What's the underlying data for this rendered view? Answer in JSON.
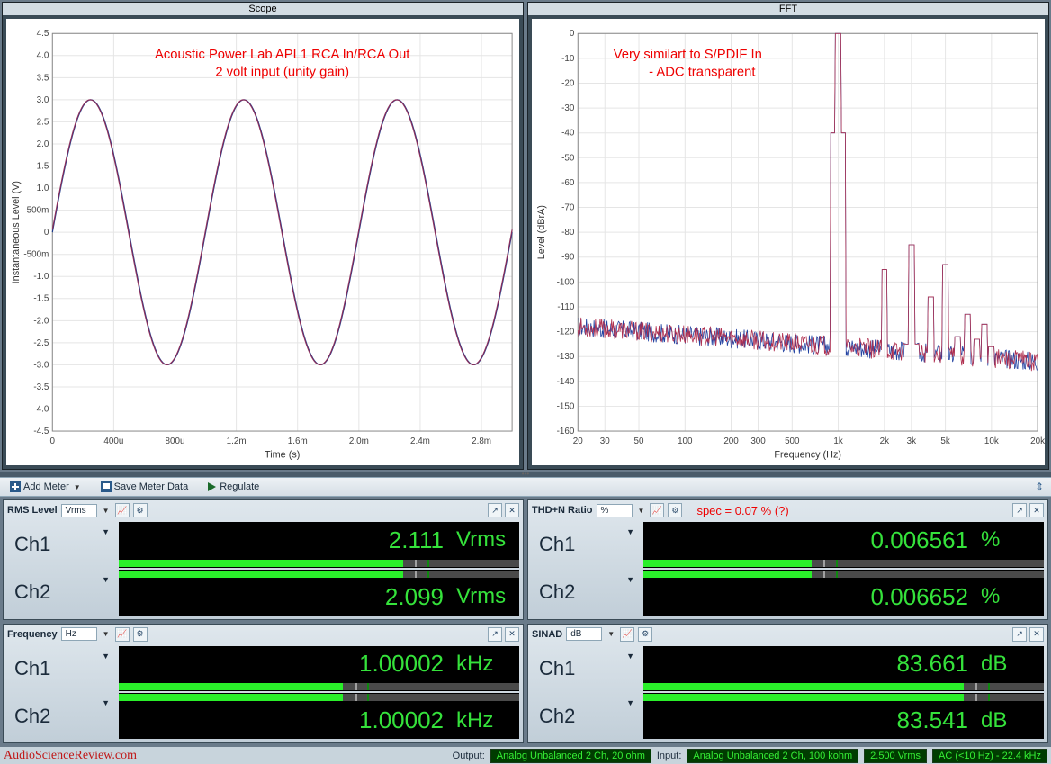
{
  "scope": {
    "title": "Scope",
    "xlabel": "Time (s)",
    "ylabel": "Instantaneous Level (V)",
    "annot1": "Acoustic Power Lab APL1 RCA In/RCA Out",
    "annot2": "2 volt input (unity gain)",
    "xticks": [
      "0",
      "400u",
      "800u",
      "1.2m",
      "1.6m",
      "2.0m",
      "2.4m",
      "2.8m"
    ],
    "yticks": [
      "-4.5",
      "-4.0",
      "-3.5",
      "-3.0",
      "-2.5",
      "-2.0",
      "-1.5",
      "-1.0",
      "-500m",
      "0",
      "500m",
      "1.0",
      "1.5",
      "2.0",
      "2.5",
      "3.0",
      "3.5",
      "4.0",
      "4.5"
    ]
  },
  "fft": {
    "title": "FFT",
    "xlabel": "Frequency (Hz)",
    "ylabel": "Level (dBrA)",
    "annot1": "Very similart to S/PDIF In",
    "annot2": "- ADC transparent",
    "xticks": [
      "20",
      "30",
      "50",
      "100",
      "200",
      "300",
      "500",
      "1k",
      "2k",
      "3k",
      "5k",
      "10k",
      "20k"
    ],
    "yticks": [
      "-160",
      "-150",
      "-140",
      "-130",
      "-120",
      "-110",
      "-100",
      "-90",
      "-80",
      "-70",
      "-60",
      "-50",
      "-40",
      "-30",
      "-20",
      "-10",
      "0"
    ]
  },
  "toolbar": {
    "add_meter": "Add Meter",
    "save_meter": "Save Meter Data",
    "regulate": "Regulate"
  },
  "meters": {
    "rms": {
      "name": "RMS Level",
      "unit": "Vrms",
      "annot": "",
      "ch1": {
        "label": "Ch1",
        "val": "2.111",
        "unit": "Vrms",
        "pct": 71
      },
      "ch2": {
        "label": "Ch2",
        "val": "2.099",
        "unit": "Vrms",
        "pct": 71
      }
    },
    "thdn": {
      "name": "THD+N Ratio",
      "unit": "%",
      "annot": "spec = 0.07 % (?)",
      "ch1": {
        "label": "Ch1",
        "val": "0.006561",
        "unit": "%",
        "pct": 42
      },
      "ch2": {
        "label": "Ch2",
        "val": "0.006652",
        "unit": "%",
        "pct": 42
      }
    },
    "freq": {
      "name": "Frequency",
      "unit": "Hz",
      "annot": "",
      "ch1": {
        "label": "Ch1",
        "val": "1.00002",
        "unit": "kHz",
        "pct": 56
      },
      "ch2": {
        "label": "Ch2",
        "val": "1.00002",
        "unit": "kHz",
        "pct": 56
      }
    },
    "sinad": {
      "name": "SINAD",
      "unit": "dB",
      "annot": "",
      "ch1": {
        "label": "Ch1",
        "val": "83.661",
        "unit": "dB",
        "pct": 80
      },
      "ch2": {
        "label": "Ch2",
        "val": "83.541",
        "unit": "dB",
        "pct": 80
      }
    }
  },
  "status": {
    "asr": "AudioScienceReview.com",
    "output_label": "Output:",
    "output_val": "Analog Unbalanced 2 Ch, 20 ohm",
    "input_label": "Input:",
    "input_val": "Analog Unbalanced 2 Ch, 100 kohm",
    "level": "2.500 Vrms",
    "bw": "AC (<10 Hz) - 22.4 kHz"
  },
  "chart_data": [
    {
      "type": "line",
      "title": "Scope",
      "xlabel": "Time (s)",
      "ylabel": "Instantaneous Level (V)",
      "xlim": [
        0,
        0.003
      ],
      "ylim": [
        -4.5,
        4.5
      ],
      "note": "sine wave, ~3.0 V peak, ~1 kHz, two overlapping channels",
      "series": [
        {
          "name": "Ch1",
          "amplitude_v": 3.0,
          "freq_hz": 1000,
          "phase_deg": 0
        },
        {
          "name": "Ch2",
          "amplitude_v": 3.0,
          "freq_hz": 1000,
          "phase_deg": 0
        }
      ]
    },
    {
      "type": "line",
      "title": "FFT",
      "xlabel": "Frequency (Hz)",
      "ylabel": "Level (dBrA)",
      "xscale": "log",
      "xlim": [
        20,
        20000
      ],
      "ylim": [
        -160,
        0
      ],
      "noise_floor_db": -130,
      "series": [
        {
          "name": "Ch1",
          "color": "#b03050",
          "peaks_hz_db": [
            [
              1000,
              0
            ],
            [
              2000,
              -95
            ],
            [
              3000,
              -85
            ],
            [
              4000,
              -106
            ],
            [
              5000,
              -93
            ],
            [
              6000,
              -122
            ],
            [
              7000,
              -113
            ],
            [
              8000,
              -123
            ],
            [
              9000,
              -117
            ],
            [
              10000,
              -126
            ]
          ]
        },
        {
          "name": "Ch2",
          "color": "#2040a0",
          "peaks_hz_db": [
            [
              1000,
              0
            ],
            [
              2000,
              -95
            ],
            [
              3000,
              -85
            ],
            [
              4000,
              -106
            ],
            [
              5000,
              -93
            ],
            [
              6000,
              -122
            ],
            [
              7000,
              -113
            ],
            [
              8000,
              -123
            ],
            [
              9000,
              -117
            ],
            [
              10000,
              -126
            ]
          ]
        }
      ]
    }
  ]
}
